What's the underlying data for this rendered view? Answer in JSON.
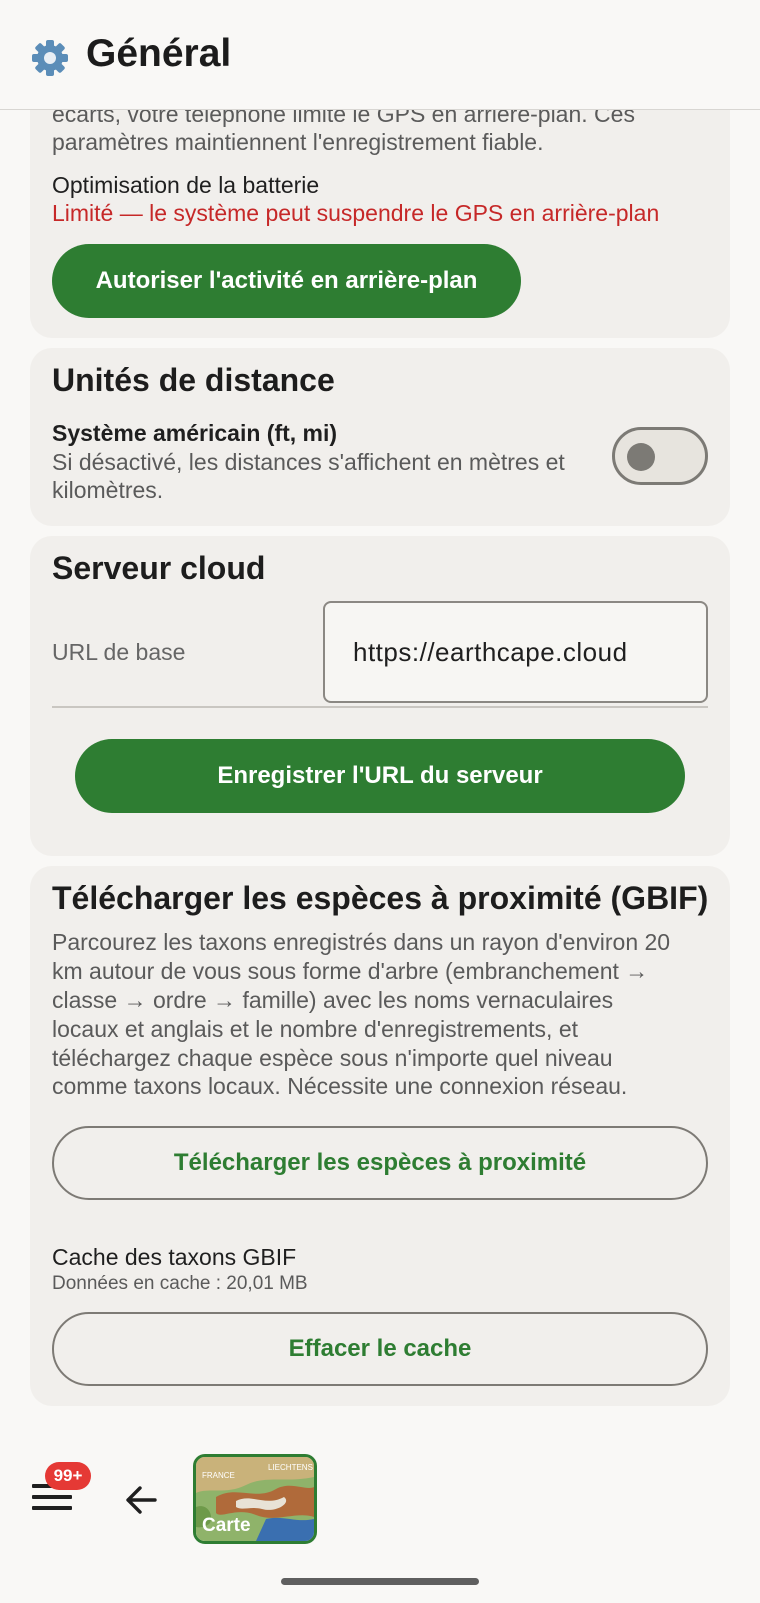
{
  "header": {
    "title": "Général",
    "icon": "gear-icon"
  },
  "battery_card": {
    "intro_line1": "écarts, votre téléphone limite le GPS en arrière-plan. Ces",
    "intro_line2": "paramètres maintiennent l'enregistrement fiable.",
    "label": "Optimisation de la batterie",
    "status": "Limité — le système peut suspendre le GPS en arrière-plan",
    "status_color": "#c62828",
    "button": "Autoriser l'activité en arrière-plan"
  },
  "units_card": {
    "title": "Unités de distance",
    "setting_label": "Système américain (ft, mi)",
    "setting_desc_line1": "Si désactivé, les distances s'affichent en mètres et",
    "setting_desc_line2": "kilomètres.",
    "toggle_on": false
  },
  "cloud_card": {
    "title": "Serveur cloud",
    "url_label": "URL de base",
    "url_value": "https://earthcape.cloud",
    "save_button": "Enregistrer l'URL du serveur"
  },
  "gbif_card": {
    "title": "Télécharger les espèces à proximité (GBIF)",
    "desc_lines": [
      "Parcourez les taxons enregistrés dans un rayon d'environ 20",
      "km autour de vous sous forme d'arbre (embranchement →",
      "classe → ordre → famille) avec les noms vernaculaires",
      "locaux et anglais et le nombre d'enregistrements, et",
      "téléchargez chaque espèce sous n'importe quel niveau",
      "comme taxons locaux. Nécessite une connexion réseau."
    ],
    "download_button": "Télécharger les espèces à proximité",
    "cache_title": "Cache des taxons GBIF",
    "cache_info": "Données en cache : 20,01 MB",
    "clear_button": "Effacer le cache"
  },
  "bottom_nav": {
    "badge": "99+",
    "map_label": "Carte",
    "map_text_1": "FRANCE",
    "map_text_2": "LIECHTENS"
  },
  "colors": {
    "accent": "#2e7d32",
    "background": "#f9f8f6",
    "card": "#f1efec",
    "badge": "#e53935"
  }
}
